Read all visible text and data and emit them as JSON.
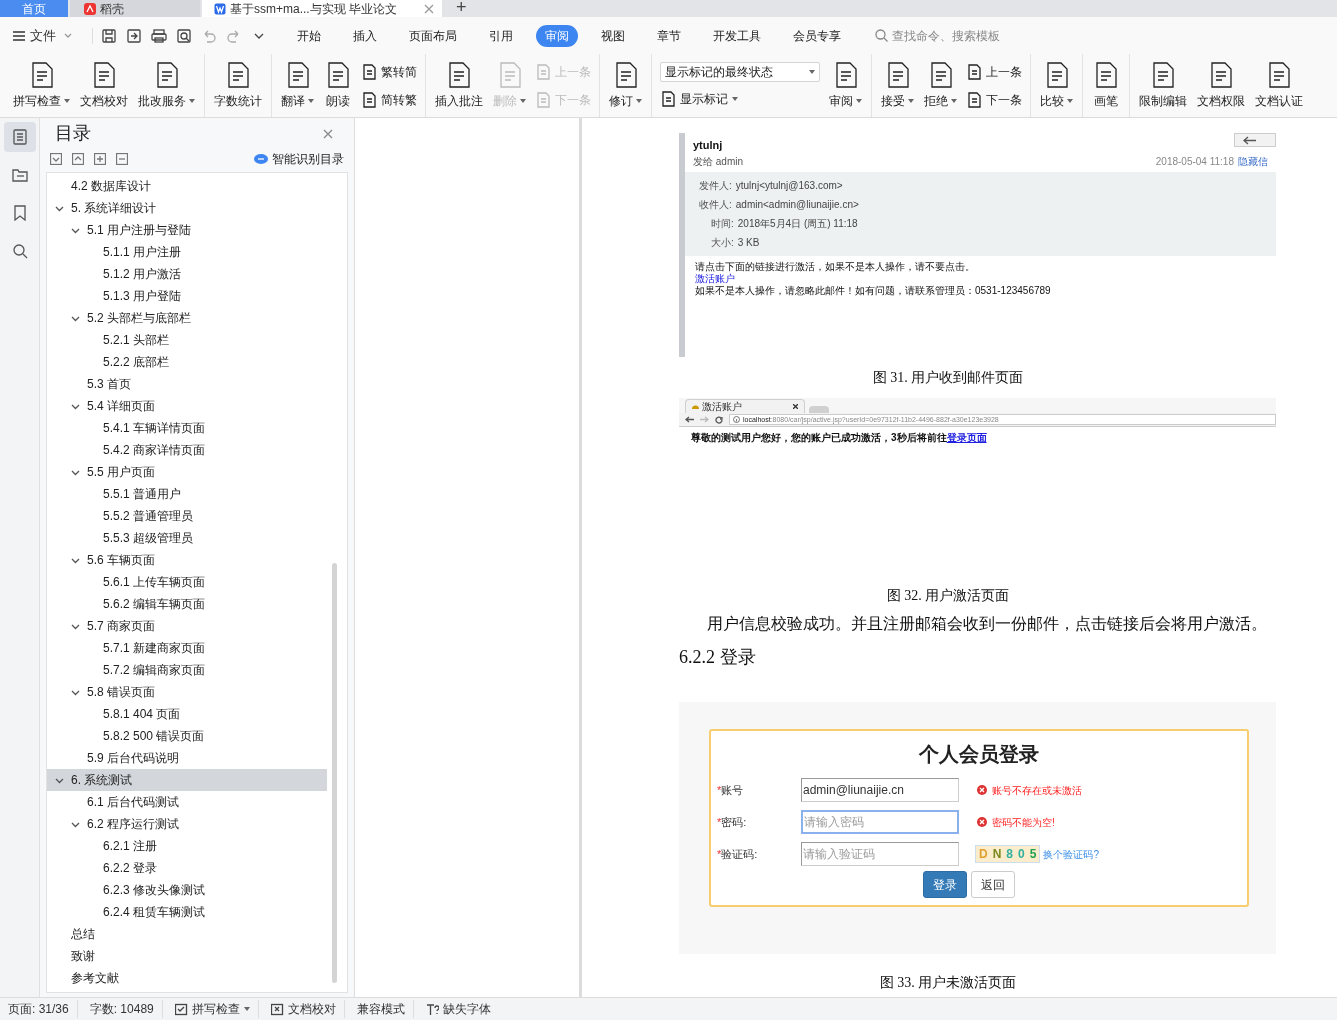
{
  "tabs": [
    {
      "label": "首页",
      "selected": false,
      "kind": "home"
    },
    {
      "label": "稻壳",
      "selected": false,
      "kind": "app"
    },
    {
      "label": "基于ssm+ma...与实现 毕业论文",
      "selected": true,
      "kind": "doc"
    }
  ],
  "new_tab": "+",
  "file_menu": "文件",
  "menu_tabs": [
    {
      "label": "开始",
      "selected": false
    },
    {
      "label": "插入",
      "selected": false
    },
    {
      "label": "页面布局",
      "selected": false
    },
    {
      "label": "引用",
      "selected": false
    },
    {
      "label": "审阅",
      "selected": true
    },
    {
      "label": "视图",
      "selected": false
    },
    {
      "label": "章节",
      "selected": false
    },
    {
      "label": "开发工具",
      "selected": false
    },
    {
      "label": "会员专享",
      "selected": false
    }
  ],
  "search": {
    "placeholder": "查找命令、搜索模板"
  },
  "ribbon_groups": [
    [
      {
        "kind": "large",
        "label": "拼写检查",
        "dropdown": true,
        "disabled": false
      },
      {
        "kind": "large",
        "label": "文档校对",
        "dropdown": false,
        "disabled": false
      },
      {
        "kind": "large",
        "label": "批改服务",
        "dropdown": true,
        "disabled": false
      }
    ],
    [
      {
        "kind": "large",
        "label": "字数统计",
        "dropdown": false,
        "disabled": false
      }
    ],
    [
      {
        "kind": "large",
        "label": "翻译",
        "dropdown": true,
        "disabled": false
      },
      {
        "kind": "large",
        "label": "朗读",
        "dropdown": false,
        "disabled": false
      },
      {
        "kind": "stack",
        "items": [
          {
            "kind": "small",
            "label": "繁转简",
            "dropdown": false,
            "disabled": false
          },
          {
            "kind": "small",
            "label": "简转繁",
            "dropdown": false,
            "disabled": false
          }
        ]
      }
    ],
    [
      {
        "kind": "large",
        "label": "插入批注",
        "dropdown": false,
        "disabled": false
      },
      {
        "kind": "large",
        "label": "删除",
        "dropdown": true,
        "disabled": true
      },
      {
        "kind": "stack",
        "items": [
          {
            "kind": "small",
            "label": "上一条",
            "dropdown": false,
            "disabled": true
          },
          {
            "kind": "small",
            "label": "下一条",
            "dropdown": false,
            "disabled": true
          }
        ]
      }
    ],
    [
      {
        "kind": "large",
        "label": "修订",
        "dropdown": true,
        "disabled": false
      }
    ],
    [
      {
        "kind": "stack",
        "items": [
          {
            "kind": "select",
            "value": "显示标记的最终状态"
          },
          {
            "kind": "small",
            "label": "显示标记",
            "dropdown": true,
            "disabled": false
          }
        ]
      },
      {
        "kind": "large",
        "label": "审阅",
        "dropdown": true,
        "disabled": false
      }
    ],
    [
      {
        "kind": "large",
        "label": "接受",
        "dropdown": true,
        "disabled": false
      },
      {
        "kind": "large",
        "label": "拒绝",
        "dropdown": true,
        "disabled": false
      },
      {
        "kind": "stack",
        "items": [
          {
            "kind": "small",
            "label": "上一条",
            "dropdown": false,
            "disabled": false
          },
          {
            "kind": "small",
            "label": "下一条",
            "dropdown": false,
            "disabled": false
          }
        ]
      }
    ],
    [
      {
        "kind": "large",
        "label": "比较",
        "dropdown": true,
        "disabled": false
      }
    ],
    [
      {
        "kind": "large",
        "label": "画笔",
        "dropdown": false,
        "disabled": false
      }
    ],
    [
      {
        "kind": "large",
        "label": "限制编辑",
        "dropdown": false,
        "disabled": false
      },
      {
        "kind": "large",
        "label": "文档权限",
        "dropdown": false,
        "disabled": false
      },
      {
        "kind": "large",
        "label": "文档认证",
        "dropdown": false,
        "disabled": false
      }
    ]
  ],
  "side_nav": [
    {
      "selected": true
    },
    {
      "selected": false
    },
    {
      "selected": false
    },
    {
      "selected": false
    }
  ],
  "toc": {
    "title": "目录",
    "smart_button": "智能识别目录",
    "items": [
      {
        "label": "4.2 数据库设计",
        "selected": false
      },
      {
        "label": "5. 系统详细设计",
        "selected": false,
        "expanded": true,
        "children": [
          {
            "label": "5.1 用户注册与登陆",
            "selected": false,
            "expanded": true,
            "children": [
              {
                "label": "5.1.1 用户注册",
                "selected": false
              },
              {
                "label": "5.1.2 用户激活",
                "selected": false
              },
              {
                "label": "5.1.3 用户登陆",
                "selected": false
              }
            ]
          },
          {
            "label": "5.2 头部栏与底部栏",
            "selected": false,
            "expanded": true,
            "children": [
              {
                "label": "5.2.1 头部栏",
                "selected": false
              },
              {
                "label": "5.2.2 底部栏",
                "selected": false
              }
            ]
          },
          {
            "label": "5.3 首页",
            "selected": false
          },
          {
            "label": "5.4 详细页面",
            "selected": false,
            "expanded": true,
            "children": [
              {
                "label": "5.4.1 车辆详情页面",
                "selected": false
              },
              {
                "label": "5.4.2 商家详情页面",
                "selected": false
              }
            ]
          },
          {
            "label": "5.5 用户页面",
            "selected": false,
            "expanded": true,
            "children": [
              {
                "label": "5.5.1 普通用户",
                "selected": false
              },
              {
                "label": "5.5.2 普通管理员",
                "selected": false
              },
              {
                "label": "5.5.3 超级管理员",
                "selected": false
              }
            ]
          },
          {
            "label": "5.6 车辆页面",
            "selected": false,
            "expanded": true,
            "children": [
              {
                "label": "5.6.1 上传车辆页面",
                "selected": false
              },
              {
                "label": "5.6.2 编辑车辆页面",
                "selected": false
              }
            ]
          },
          {
            "label": "5.7 商家页面",
            "selected": false,
            "expanded": true,
            "children": [
              {
                "label": "5.7.1 新建商家页面",
                "selected": false
              },
              {
                "label": "5.7.2 编辑商家页面",
                "selected": false
              }
            ]
          },
          {
            "label": "5.8 错误页面",
            "selected": false,
            "expanded": true,
            "children": [
              {
                "label": "5.8.1 404 页面",
                "selected": false
              },
              {
                "label": "5.8.2 500 错误页面",
                "selected": false
              }
            ]
          },
          {
            "label": "5.9 后台代码说明",
            "selected": false
          }
        ]
      },
      {
        "label": "6. 系统测试",
        "selected": true,
        "expanded": true,
        "children": [
          {
            "label": "6.1 后台代码测试",
            "selected": false
          },
          {
            "label": "6.2 程序运行测试",
            "selected": false,
            "expanded": true,
            "children": [
              {
                "label": "6.2.1 注册",
                "selected": false
              },
              {
                "label": "6.2.2 登录",
                "selected": false
              },
              {
                "label": "6.2.3 修改头像测试",
                "selected": false
              },
              {
                "label": "6.2.4 租赁车辆测试",
                "selected": false
              }
            ]
          }
        ]
      },
      {
        "label": "总结",
        "selected": false
      },
      {
        "label": "致谢",
        "selected": false
      },
      {
        "label": "参考文献",
        "selected": false
      }
    ]
  },
  "document": {
    "email": {
      "sender": "ytulnj",
      "to_line": "发给 admin",
      "date": "2018-05-04 11:18",
      "hide_link": "隐藏信",
      "details": [
        {
          "label": "发件人:",
          "value": "ytulnj<ytulnj@163.com>"
        },
        {
          "label": "收件人:",
          "value": "admin<admin@liunaijie.cn>"
        },
        {
          "label": "时间:",
          "value": "2018年5月4日 (周五) 11:18"
        },
        {
          "label": "大小:",
          "value": "3 KB"
        }
      ],
      "body": "请点击下面的链接进行激活，如果不是本人操作，请不要点击。",
      "link": "激活账户",
      "footer": "如果不是本人操作，请忽略此邮件！如有问题，请联系管理员：0531-123456789"
    },
    "caption_1": "图 31. 用户收到邮件页面",
    "browser": {
      "tab": "激活账户",
      "url_host": "localhost",
      "url_rest": ":8080/car/jsp/active.jsp?userId=0e97312f-11b2-4496-882f-a30e123e3928",
      "message": "尊敬的测试用户您好，您的账户已成功激活，3秒后将前往",
      "link": "登录页面"
    },
    "caption_2": "图 32. 用户激活页面",
    "paragraph": "用户信息校验成功。并且注册邮箱会收到一份邮件，点击链接后会将用户激活。",
    "heading": "6.2.2 登录",
    "login": {
      "title": "个人会员登录",
      "required_mark": "*",
      "fields": [
        {
          "label": "账号",
          "value": "admin@liunaijie.cn",
          "focused": false,
          "error": "账号不存在或未激活"
        },
        {
          "label": "密码:",
          "placeholder": "请输入密码",
          "focused": true,
          "error": "密码不能为空!"
        },
        {
          "label": "验证码:",
          "placeholder": "请输入验证码",
          "focused": false
        }
      ],
      "captcha": [
        {
          "char": "D",
          "color": "#e0a030"
        },
        {
          "char": "N",
          "color": "#7a8a20"
        },
        {
          "char": "8",
          "color": "#30b0a0"
        },
        {
          "char": "0",
          "color": "#30b0a0"
        },
        {
          "char": "5",
          "color": "#20a050"
        }
      ],
      "captcha_link": "换个验证码?",
      "buttons": [
        {
          "label": "登录",
          "kind": "primary"
        },
        {
          "label": "返回",
          "kind": "default"
        }
      ]
    },
    "caption_3": "图 33. 用户未激活页面"
  },
  "status_bar": [
    {
      "kind": "text",
      "label": "页面: 31/36"
    },
    {
      "kind": "text",
      "label": "字数: 10489"
    },
    {
      "kind": "check",
      "label": "拼写检查",
      "dropdown": true
    },
    {
      "kind": "proof",
      "label": "文档校对",
      "dropdown": false
    },
    {
      "kind": "text",
      "label": "兼容模式"
    },
    {
      "kind": "font",
      "label": "缺失字体",
      "dropdown": false
    }
  ]
}
